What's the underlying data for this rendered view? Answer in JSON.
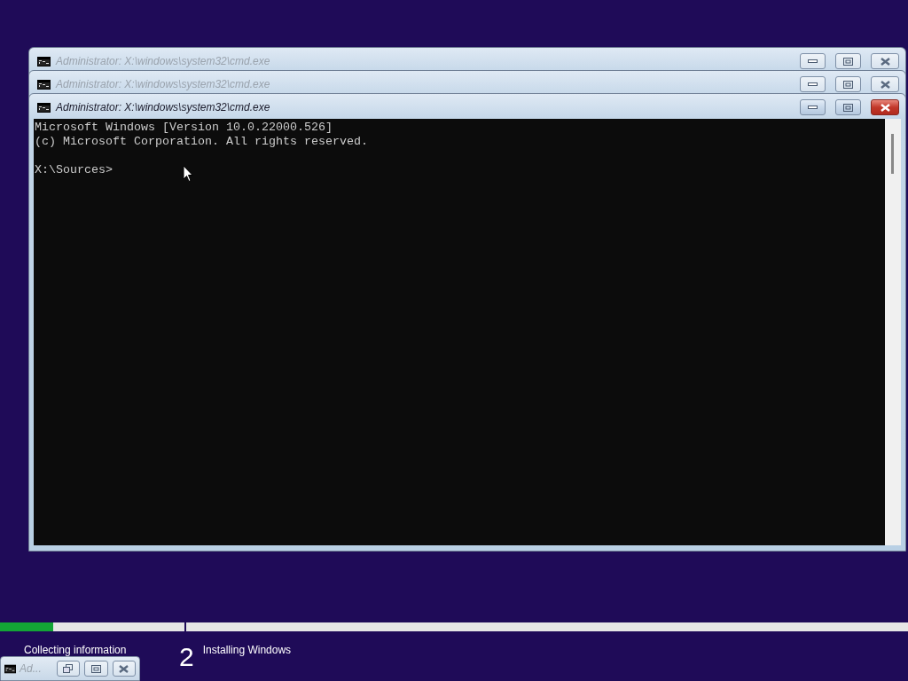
{
  "windows": [
    {
      "title": "Administrator: X:\\windows\\system32\\cmd.exe",
      "active": false
    },
    {
      "title": "Administrator: X:\\windows\\system32\\cmd.exe",
      "active": false
    },
    {
      "title": "Administrator: X:\\windows\\system32\\cmd.exe",
      "active": true,
      "paragraphs": [
        {
          "lines": [
            "Microsoft Windows [Version 10.0.22000.526]",
            "(c) Microsoft Corporation. All rights reserved."
          ]
        },
        {
          "lines": [
            "X:\\Sources>"
          ]
        }
      ]
    }
  ],
  "progress": {
    "level": 0.059
  },
  "steps": [
    {
      "label": "Collecting information"
    },
    {
      "number": "2",
      "label": "Installing Windows"
    }
  ],
  "minimized_window": {
    "title": "Ad..."
  }
}
